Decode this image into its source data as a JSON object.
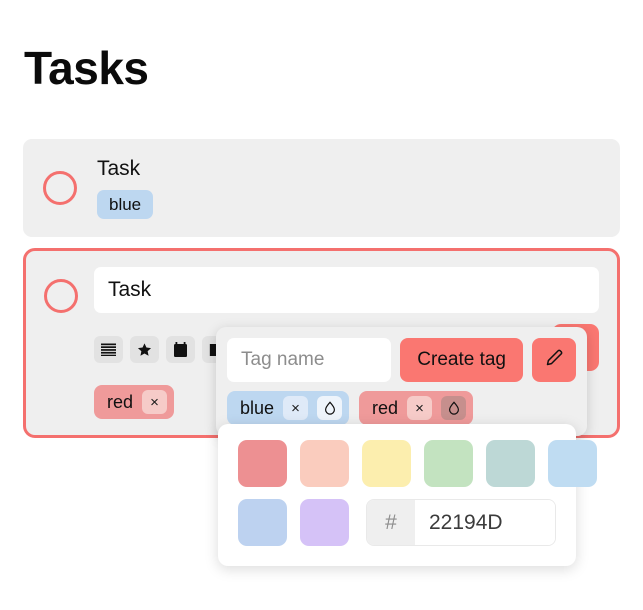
{
  "page": {
    "title": "Tasks"
  },
  "tasks": [
    {
      "title": "Task",
      "tags": [
        {
          "label": "blue",
          "color": "#bdd7f0"
        }
      ]
    },
    {
      "title": "Task",
      "tags": [
        {
          "label": "red",
          "color": "#ef9a9a",
          "remove_label": "×"
        }
      ],
      "toolbar": [
        {
          "name": "list-icon"
        },
        {
          "name": "star-icon"
        },
        {
          "name": "calendar-icon"
        },
        {
          "name": "tag-icon"
        }
      ]
    }
  ],
  "tag_popup": {
    "input_value": "",
    "input_placeholder": "Tag name",
    "create_label": "Create tag",
    "edit_icon": "pencil-icon",
    "tags": [
      {
        "label": "blue",
        "color": "#bdd7f0",
        "remove_label": "×",
        "color_icon": "droplet-icon",
        "color_active": false
      },
      {
        "label": "red",
        "color": "#ef9a9a",
        "remove_label": "×",
        "color_icon": "droplet-icon",
        "color_active": true
      }
    ]
  },
  "color_picker": {
    "swatches_row1": [
      "#ed9092",
      "#faccbe",
      "#fceeae",
      "#c3e3c0",
      "#bdd8d6",
      "#bfdcf2"
    ],
    "swatches_row2": [
      "#bdd2f0",
      "#d5c2f7"
    ],
    "hex_prefix": "#",
    "hex_value": "22194D",
    "hex_placeholder": "22194D"
  },
  "colors": {
    "accent": "#fa7771",
    "ring": "#f4706e",
    "card_bg": "#efefef"
  }
}
